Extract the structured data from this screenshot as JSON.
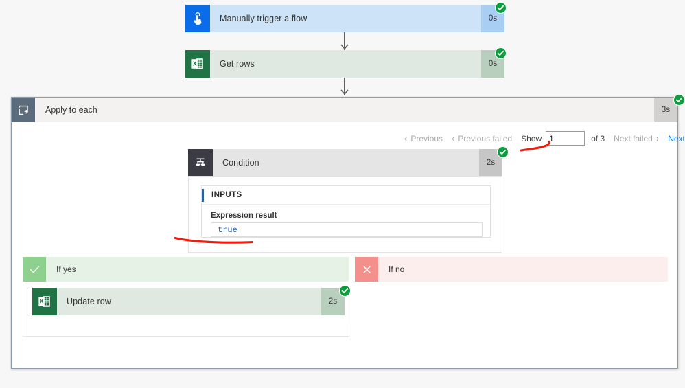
{
  "flow": {
    "trigger": {
      "name": "Manually trigger a flow",
      "duration": "0s",
      "status": "succeeded",
      "icon": "touch-trigger-icon",
      "accent": "#0a6ce8"
    },
    "actions": [
      {
        "name": "Get rows",
        "duration": "0s",
        "status": "succeeded",
        "icon": "excel-icon",
        "accent": "#217346"
      }
    ],
    "scope": {
      "name": "Apply to each",
      "duration": "3s",
      "status": "succeeded",
      "icon": "foreach-loop-icon",
      "accent": "#5b6c7f"
    },
    "pager": {
      "previous_label": "Previous",
      "previous_failed_label": "Previous failed",
      "show_label": "Show",
      "page_value": "1",
      "page_placeholder": "",
      "of_label": "of 3",
      "next_failed_label": "Next failed",
      "next_label": "Next",
      "chevron_left": "‹",
      "chevron_right": "›"
    },
    "condition": {
      "name": "Condition",
      "duration": "2s",
      "status": "succeeded",
      "icon": "condition-branch-icon",
      "inputs_header": "INPUTS",
      "expression_label": "Expression result",
      "expression_value": "true"
    },
    "branches": {
      "yes": {
        "label": "If yes",
        "icon": "check-icon",
        "actions": [
          {
            "name": "Update row",
            "duration": "2s",
            "status": "succeeded",
            "icon": "excel-icon",
            "accent": "#217346"
          }
        ]
      },
      "no": {
        "label": "If no",
        "icon": "x-icon",
        "actions": []
      }
    }
  },
  "annotations": {
    "color": "#f41b0c",
    "marks": [
      {
        "name": "underline-page-number"
      },
      {
        "name": "underline-expression-result"
      }
    ]
  },
  "colors": {
    "success_green": "#0c9d3e",
    "trigger_blue": "#cde3f8",
    "excel_green": "#dfe9e1",
    "condition_gray": "#e5e5e5",
    "yes_green": "#e6f2e6",
    "no_red": "#fdeeee",
    "link_blue": "#0b6fd4",
    "value_blue": "#2662b5"
  }
}
